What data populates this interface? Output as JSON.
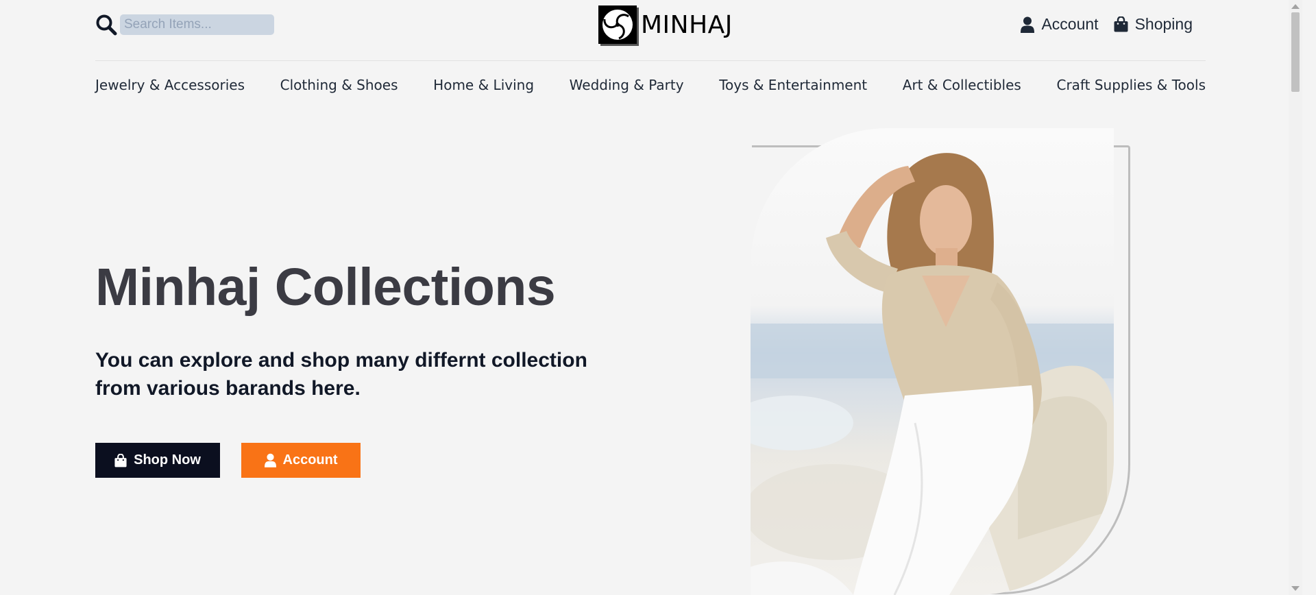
{
  "header": {
    "search": {
      "placeholder": "Search Items...",
      "icon": "search-icon"
    },
    "logo": {
      "text": "MINHAJ",
      "icon": "swirl-logo-icon"
    },
    "account_label": "Account",
    "shopping_label": "Shoping"
  },
  "nav": {
    "items": [
      "Jewelry & Accessories",
      "Clothing & Shoes",
      "Home & Living",
      "Wedding & Party",
      "Toys & Entertainment",
      "Art & Collectibles",
      "Craft Supplies & Tools"
    ]
  },
  "hero": {
    "title": "Minhaj Collections",
    "subtitle": "You can explore and shop many differnt collection from various barands here.",
    "shop_button": "Shop Now",
    "account_button": "Account"
  },
  "colors": {
    "background": "#f4f4f4",
    "shop_button": "#0b0f1f",
    "account_button": "#f97316",
    "search_field": "#cbd5e1",
    "title": "#3b3b43"
  }
}
